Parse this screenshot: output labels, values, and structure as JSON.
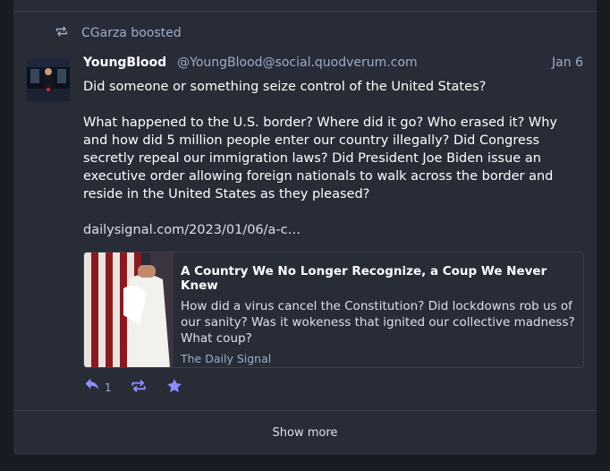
{
  "boost": {
    "icon": "retweet-icon",
    "text": "CGarza boosted"
  },
  "post": {
    "display_name": "YoungBlood",
    "handle": "@YoungBlood@social.quodverum.com",
    "date": "Jan 6",
    "paragraph1": "Did someone or something seize control of the United States?",
    "paragraph2": "What happened to the U.S. border? Where did it go? Who erased it? Why and how did 5 million people enter our country illegally? Did Congress secretly repeal our immigration laws? Did President Joe Biden issue an executive order allowing foreign nationals to walk across the border and reside in the United States as they pleased?",
    "link": "dailysignal.com/2023/01/06/a-c…"
  },
  "card": {
    "title": "A Country We No Longer Recognize, a Coup We Never Knew",
    "description": "How did a virus cancel the Constitution? Did lockdowns rob us of our sanity? Was it wokeness that ignited our collective madness? What coup?",
    "provider": "The Daily Signal"
  },
  "actions": {
    "reply_count": "1",
    "reply_icon": "reply-icon",
    "boost_icon": "retweet-icon",
    "favourite_icon": "star-icon"
  },
  "show_more": "Show more",
  "colors": {
    "background": "#191b22",
    "panel": "#282c37",
    "muted": "#9baec8",
    "accent": "#8c8dff"
  }
}
